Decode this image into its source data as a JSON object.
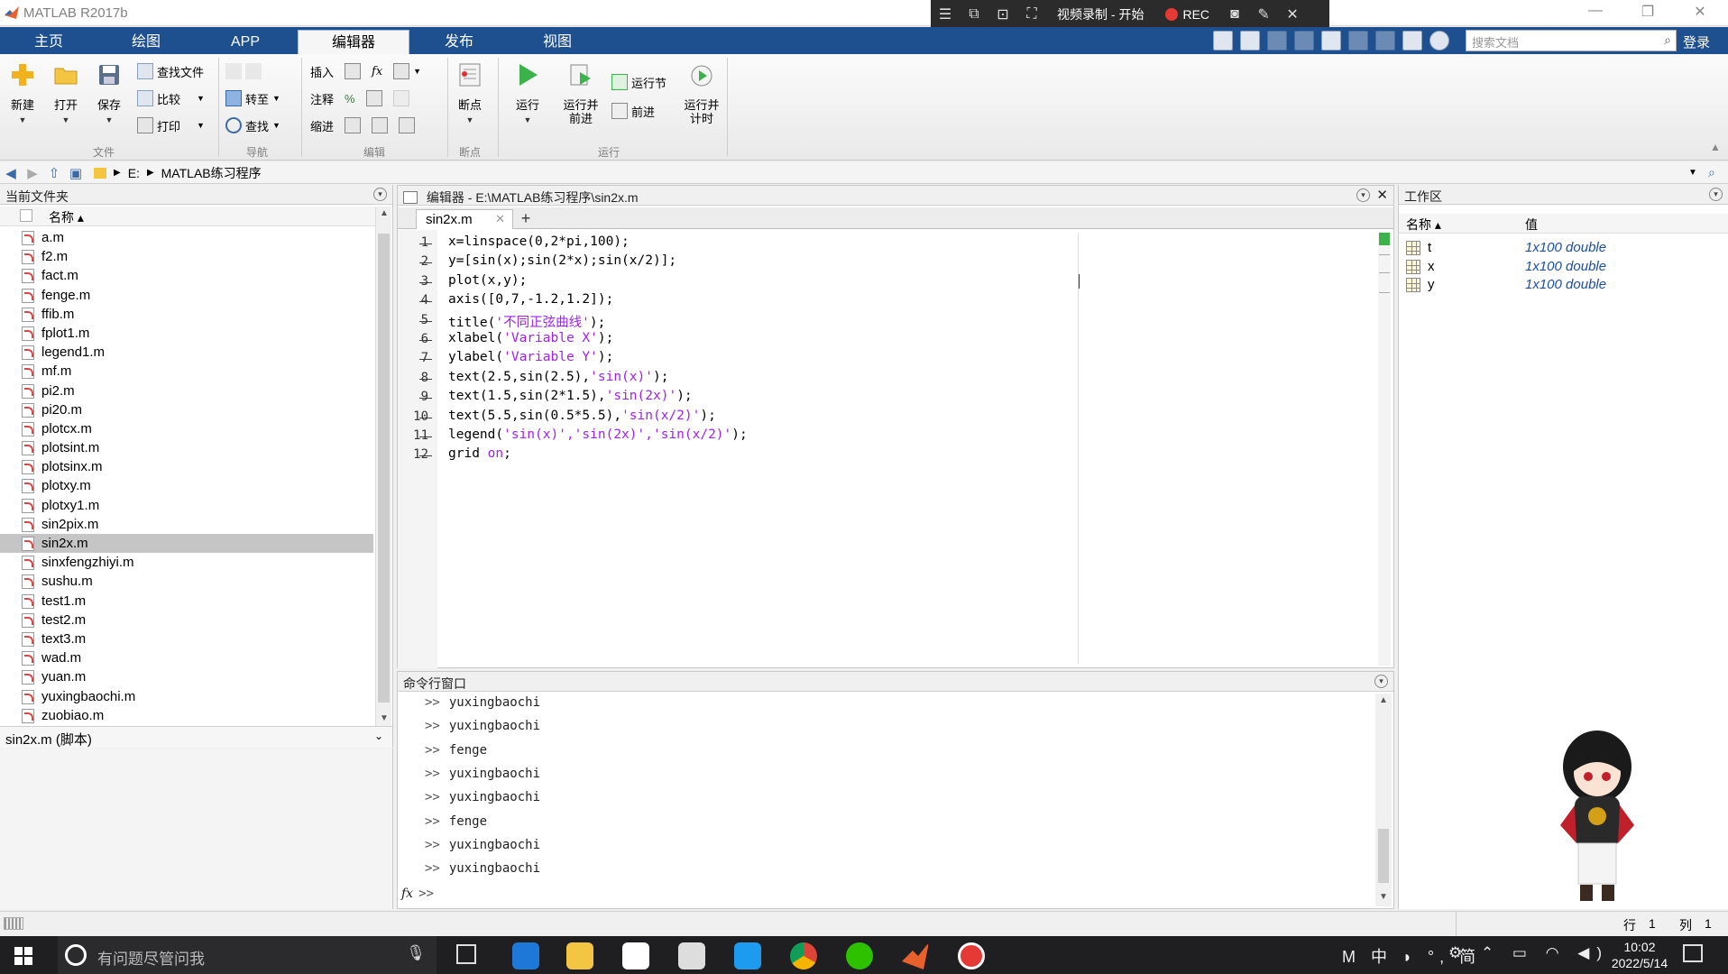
{
  "window": {
    "title": "MATLAB R2017b"
  },
  "recorder": {
    "title": "视频录制 - 开始",
    "rec_label": "REC"
  },
  "ribbon_tabs": [
    "主页",
    "绘图",
    "APP",
    "编辑器",
    "发布",
    "视图"
  ],
  "search": {
    "placeholder": "搜索文档"
  },
  "login_label": "登录",
  "ribbon": {
    "file_group": {
      "label": "文件",
      "new": "新建",
      "open": "打开",
      "save": "保存",
      "find_files": "查找文件",
      "compare": "比较",
      "print": "打印"
    },
    "nav_group": {
      "label": "导航",
      "goto": "转至",
      "find": "查找"
    },
    "edit_group": {
      "label": "编辑",
      "insert": "插入",
      "comment": "注释",
      "indent": "缩进",
      "fx": "fx"
    },
    "breakpoints_group": {
      "label": "断点",
      "breakpoints": "断点"
    },
    "run_group": {
      "label": "运行",
      "run": "运行",
      "run_advance": "运行并\n前进",
      "run_section": "运行节",
      "advance": "前进",
      "run_time": "运行并\n计时"
    }
  },
  "address": {
    "drive": "E:",
    "folder": "MATLAB练习程序"
  },
  "current_folder": {
    "title": "当前文件夹",
    "column_name": "名称 ▴",
    "files": [
      "a.m",
      "f2.m",
      "fact.m",
      "fenge.m",
      "ffib.m",
      "fplot1.m",
      "legend1.m",
      "mf.m",
      "pi2.m",
      "pi20.m",
      "plotcx.m",
      "plotsint.m",
      "plotsinx.m",
      "plotxy.m",
      "plotxy1.m",
      "sin2pix.m",
      "sin2x.m",
      "sinxfengzhiyi.m",
      "sushu.m",
      "test1.m",
      "test2.m",
      "text3.m",
      "wad.m",
      "yuan.m",
      "yuxingbaochi.m",
      "zuobiao.m"
    ],
    "selected": "sin2x.m",
    "details_label": "sin2x.m  (脚本)"
  },
  "editor": {
    "title": "编辑器 - E:\\MATLAB练习程序\\sin2x.m",
    "tab": "sin2x.m",
    "lines": [
      {
        "n": "1",
        "text": "x=linspace(0,2*pi,100);"
      },
      {
        "n": "2",
        "text": "y=[sin(x);sin(2*x);sin(x/2)];"
      },
      {
        "n": "3",
        "text": "plot(x,y);"
      },
      {
        "n": "4",
        "text": "axis([0,7,-1.2,1.2]);"
      },
      {
        "n": "5",
        "pre": "title(",
        "str": "'不同正弦曲线'",
        "post": ");"
      },
      {
        "n": "6",
        "pre": "xlabel(",
        "str": "'Variable X'",
        "post": ");"
      },
      {
        "n": "7",
        "pre": "ylabel(",
        "str": "'Variable Y'",
        "post": ");"
      },
      {
        "n": "8",
        "pre": "text(2.5,sin(2.5),",
        "str": "'sin(x)'",
        "post": ");"
      },
      {
        "n": "9",
        "pre": "text(1.5,sin(2*1.5),",
        "str": "'sin(2x)'",
        "post": ");"
      },
      {
        "n": "10",
        "pre": "text(5.5,sin(0.5*5.5),",
        "str": "'sin(x/2)'",
        "post": ");"
      },
      {
        "n": "11",
        "pre": "legend(",
        "str": "'sin(x)','sin(2x)','sin(x/2)'",
        "post": ");"
      },
      {
        "n": "12",
        "pre": "grid ",
        "str": "on",
        "post": ";"
      }
    ]
  },
  "command_window": {
    "title": "命令行窗口",
    "prompt": ">>",
    "history": [
      "yuxingbaochi",
      "yuxingbaochi",
      "fenge",
      "yuxingbaochi",
      "yuxingbaochi",
      "fenge",
      "yuxingbaochi",
      "yuxingbaochi"
    ],
    "fx": "fx"
  },
  "workspace": {
    "title": "工作区",
    "col_name": "名称 ▴",
    "col_value": "值",
    "vars": [
      {
        "name": "t",
        "value": "1x100 double"
      },
      {
        "name": "x",
        "value": "1x100 double"
      },
      {
        "name": "y",
        "value": "1x100 double"
      }
    ]
  },
  "status": {
    "row_label": "行",
    "row": "1",
    "col_label": "列",
    "col": "1"
  },
  "taskbar": {
    "search_placeholder": "有问题尽管问我",
    "time": "10:02",
    "date": "2022/5/14",
    "ime": "M 中 ◗ °, 简"
  },
  "colors": {
    "tab_bar": "#1e4f8e",
    "string": "#a020f0",
    "workspace_value": "#1d4fa0",
    "rec": "#e53935"
  }
}
